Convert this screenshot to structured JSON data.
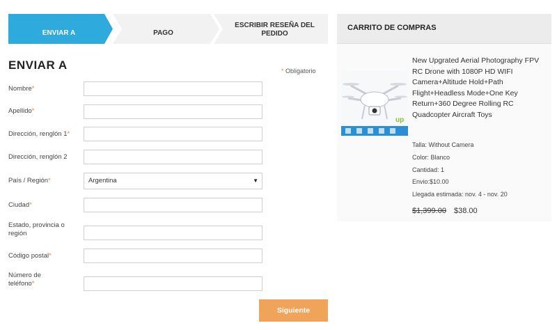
{
  "steps": [
    {
      "label": "ENVIAR A"
    },
    {
      "label": "PAGO"
    },
    {
      "label": "ESCRIBIR RESEÑA DEL PEDIDO"
    }
  ],
  "colors": {
    "active_step": "#2eaadc",
    "inactive_step": "#f2f2f2",
    "accent": "#f0a45a",
    "required_star": "#e8863a"
  },
  "form": {
    "title": "ENVIAR A",
    "required_note": "Obligatorio",
    "required_star": "*",
    "fields": {
      "nombre": {
        "label": "Nombre",
        "value": ""
      },
      "apellido": {
        "label": "Apellido",
        "value": ""
      },
      "direccion1": {
        "label": "Dirección, renglón 1",
        "value": ""
      },
      "direccion2": {
        "label": "Dirección, renglón 2",
        "value": ""
      },
      "pais": {
        "label": "País / Región",
        "value": "Argentina"
      },
      "ciudad": {
        "label": "Ciudad",
        "value": ""
      },
      "estado": {
        "label": "Estado, provincia o región",
        "value": ""
      },
      "postal": {
        "label": "Código postal",
        "value": ""
      },
      "telefono": {
        "label": "Número de teléfono",
        "value": ""
      }
    },
    "next_button": "Siguiente"
  },
  "cart": {
    "title": "CARRITO DE COMPRAS",
    "product": {
      "title": "New Upgrated Aerial Photography FPV RC Drone with 1080P HD WIFI Camera+Altitude Hold+Path Flight+Headless Mode+One Key Return+360 Degree Rolling RC Quadcopter Aircraft Toys",
      "image_icon": "drone-image",
      "details": [
        "Talla: Without Camera",
        "Color: Blanco",
        "Cantidad: 1",
        "Envio:$10.00",
        "Llegada estimada: nov. 4 - nov. 20"
      ],
      "price_old": "$1,399.00",
      "price_new": "$38.00"
    }
  }
}
